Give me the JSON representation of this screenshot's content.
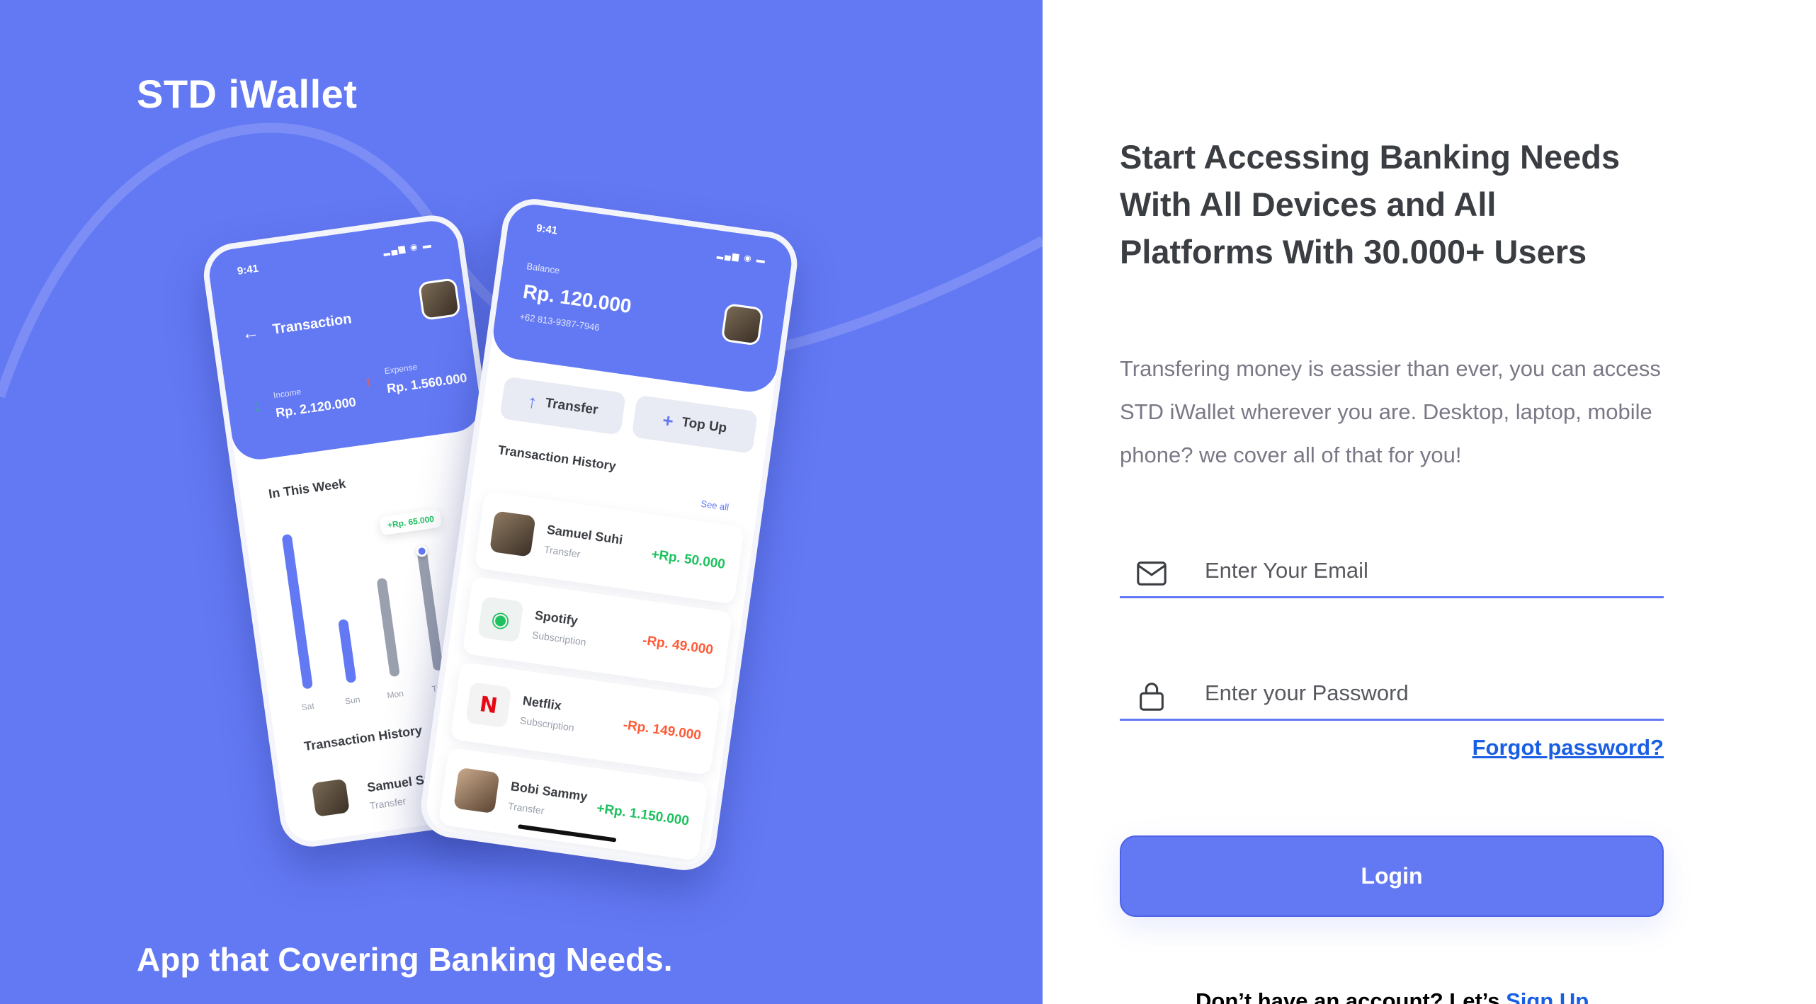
{
  "brand": {
    "name": "STD iWallet",
    "tagline": "App that Covering Banking Needs."
  },
  "phone_left": {
    "time": "9:41",
    "title": "Transaction",
    "income_label": "Income",
    "income_value": "Rp. 2.120.000",
    "expense_label": "Expense",
    "expense_value": "Rp. 1.560.000",
    "week_title": "In This Week",
    "bubble": "+Rp. 65.000",
    "days": [
      "Sat",
      "Sun",
      "Mon",
      "Tue"
    ],
    "history_title": "Transaction History",
    "history_item": {
      "name": "Samuel Suhi",
      "sub": "Transfer"
    }
  },
  "phone_right": {
    "time": "9:41",
    "balance_label": "Balance",
    "balance_value": "Rp. 120.000",
    "phone_number": "+62 813-9387-7946",
    "transfer_label": "Transfer",
    "topup_label": "Top Up",
    "history_title": "Transaction History",
    "see_all": "See all",
    "transactions": [
      {
        "name": "Samuel Suhi",
        "sub": "Transfer",
        "amount": "+Rp. 50.000",
        "type": "in"
      },
      {
        "name": "Spotify",
        "sub": "Subscription",
        "amount": "-Rp. 49.000",
        "type": "out"
      },
      {
        "name": "Netflix",
        "sub": "Subscription",
        "amount": "-Rp. 149.000",
        "type": "out"
      },
      {
        "name": "Bobi Sammy",
        "sub": "Transfer",
        "amount": "+Rp. 1.150.000",
        "type": "in"
      }
    ]
  },
  "login": {
    "headline": "Start Accessing Banking Needs With All Devices and All Platforms With 30.000+ Users",
    "description": "Transfering money is eassier than ever, you can access STD iWallet wherever you are. Desktop, laptop, mobile phone? we cover all of that for you!",
    "email_placeholder": "Enter Your Email",
    "password_placeholder": "Enter your Password",
    "forgot_label": "Forgot password?",
    "login_button": "Login",
    "signup_prefix": "Don’t have an account? Let’s ",
    "signup_link": "Sign Up"
  },
  "colors": {
    "primary": "#6379F4",
    "text_dark": "#3A3D42",
    "text_muted": "#7A7886",
    "income": "#1EC15F",
    "expense": "#FF5B37",
    "link": "#1A5FE3"
  }
}
